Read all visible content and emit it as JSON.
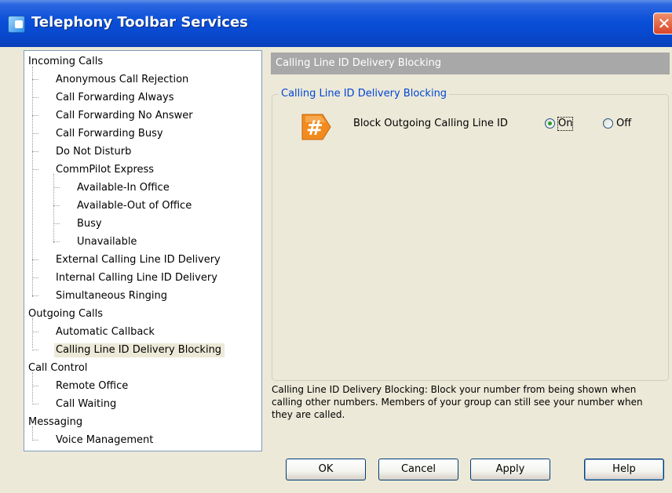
{
  "window": {
    "title": "Telephony Toolbar Services",
    "close_glyph": "✕"
  },
  "tree": {
    "incoming_calls": "Incoming Calls",
    "anonymous_call_rejection": "Anonymous Call Rejection",
    "call_forwarding_always": "Call Forwarding Always",
    "call_forwarding_no_answer": "Call Forwarding No Answer",
    "call_forwarding_busy": "Call Forwarding Busy",
    "do_not_disturb": "Do Not Disturb",
    "commpilot_express": "CommPilot Express",
    "available_in_office": "Available-In Office",
    "available_out_of_office": "Available-Out of Office",
    "busy": "Busy",
    "unavailable": "Unavailable",
    "external_clid_delivery": "External Calling Line ID Delivery",
    "internal_clid_delivery": "Internal Calling Line ID Delivery",
    "simultaneous_ringing": "Simultaneous Ringing",
    "outgoing_calls": "Outgoing Calls",
    "automatic_callback": "Automatic Callback",
    "clid_delivery_blocking": "Calling Line ID Delivery Blocking",
    "call_control": "Call Control",
    "remote_office": "Remote Office",
    "call_waiting": "Call Waiting",
    "messaging": "Messaging",
    "voice_management": "Voice Management"
  },
  "panel": {
    "header": "Calling Line ID Delivery Blocking",
    "group_label": "Calling Line ID Delivery Blocking",
    "setting_label": "Block Outgoing Calling Line ID",
    "on_label": "On",
    "off_label": "Off",
    "selected": "On",
    "description": "Calling Line ID Delivery Blocking: Block your number from being shown when calling other numbers. Members of your group can still see your number when they are called."
  },
  "buttons": {
    "ok": "OK",
    "cancel": "Cancel",
    "apply": "Apply",
    "help": "Help"
  },
  "colors": {
    "title_bar": "#0a4fd8",
    "group_label": "#0046d5",
    "header_bg": "#a8a8a8",
    "icon_orange": "#f28b1e"
  }
}
